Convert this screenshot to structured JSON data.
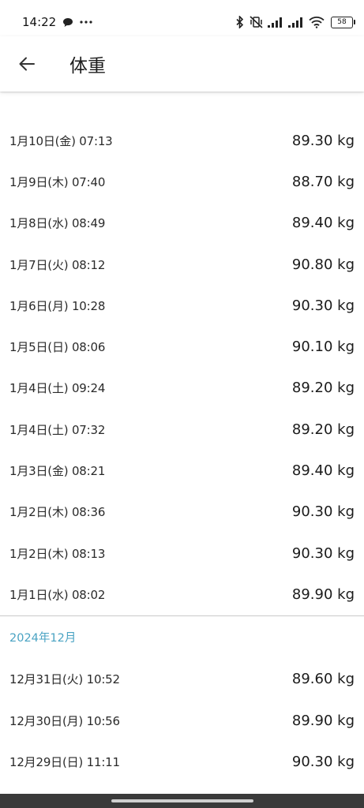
{
  "status_bar": {
    "time": "14:22",
    "battery": "58"
  },
  "app_bar": {
    "title": "体重"
  },
  "entries_january": [
    {
      "date": "1月10日(金) 07:13",
      "weight": "89.30 kg"
    },
    {
      "date": "1月9日(木) 07:40",
      "weight": "88.70 kg"
    },
    {
      "date": "1月8日(水) 08:49",
      "weight": "89.40 kg"
    },
    {
      "date": "1月7日(火) 08:12",
      "weight": "90.80 kg"
    },
    {
      "date": "1月6日(月) 10:28",
      "weight": "90.30 kg"
    },
    {
      "date": "1月5日(日) 08:06",
      "weight": "90.10 kg"
    },
    {
      "date": "1月4日(土) 09:24",
      "weight": "89.20 kg"
    },
    {
      "date": "1月4日(土) 07:32",
      "weight": "89.20 kg"
    },
    {
      "date": "1月3日(金) 08:21",
      "weight": "89.40 kg"
    },
    {
      "date": "1月2日(木) 08:36",
      "weight": "90.30 kg"
    },
    {
      "date": "1月2日(木) 08:13",
      "weight": "90.30 kg"
    },
    {
      "date": "1月1日(水) 08:02",
      "weight": "89.90 kg"
    }
  ],
  "section_december": {
    "header": "2024年12月"
  },
  "entries_december": [
    {
      "date": "12月31日(火) 10:52",
      "weight": "89.60 kg"
    },
    {
      "date": "12月30日(月) 10:56",
      "weight": "89.90 kg"
    },
    {
      "date": "12月29日(日) 11:11",
      "weight": "90.30 kg"
    }
  ],
  "icons": {
    "back": "arrow-back-icon",
    "chat": "chat-bubble-icon",
    "more": "more-dots-icon",
    "bluetooth": "bluetooth-icon",
    "vibrate_off": "vibrate-off-icon",
    "signal": "signal-icon",
    "wifi": "wifi-icon",
    "battery": "battery-icon"
  },
  "colors": {
    "section_header": "#4aa3c3",
    "nav_bar": "#3a3a3a"
  }
}
